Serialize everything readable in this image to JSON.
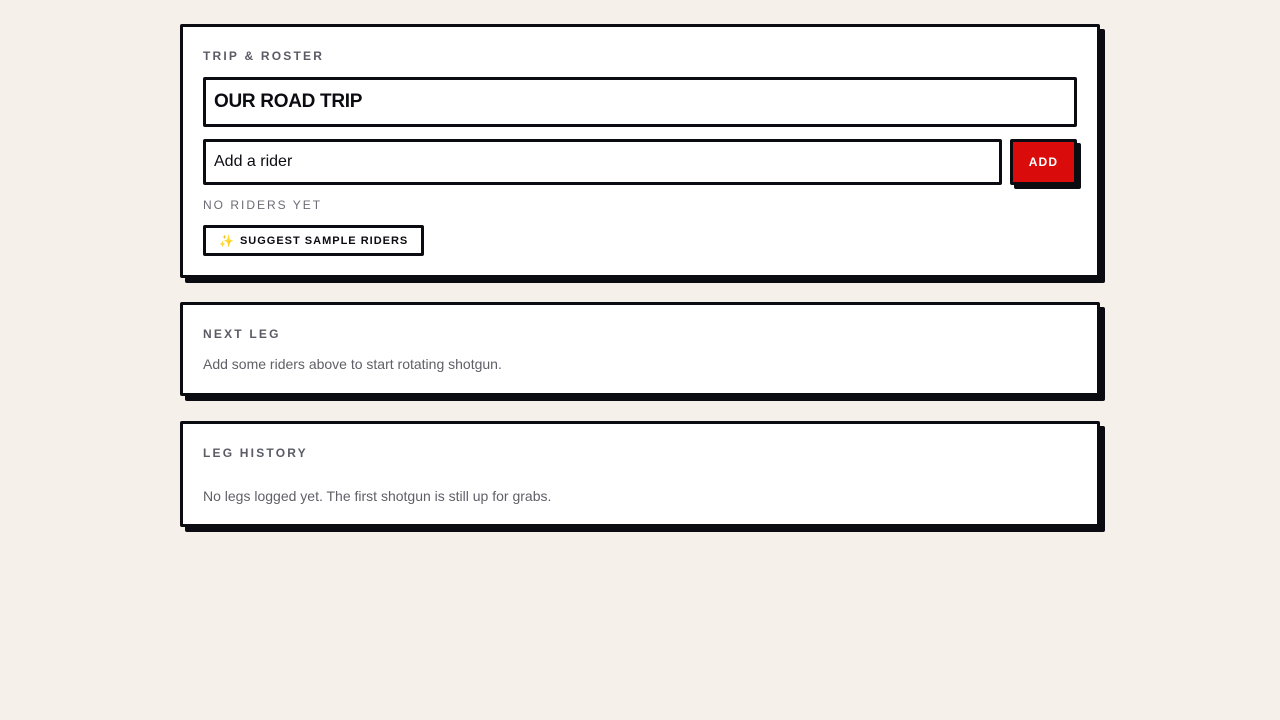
{
  "trip_roster": {
    "title": "TRIP & ROSTER",
    "trip_name_value": "OUR ROAD TRIP",
    "rider_input_placeholder": "Add a rider",
    "add_label": "ADD",
    "empty_text": "NO RIDERS YET",
    "suggest_icon": "✨",
    "suggest_label": "SUGGEST SAMPLE RIDERS"
  },
  "next_leg": {
    "title": "NEXT LEG",
    "message": "Add some riders above to start rotating shotgun."
  },
  "leg_history": {
    "title": "LEG HISTORY",
    "message": "No legs logged yet. The first shotgun is still up for grabs."
  },
  "colors": {
    "background": "#f5f1ea",
    "accent": "#d90b0b",
    "border": "#0b0b12"
  }
}
